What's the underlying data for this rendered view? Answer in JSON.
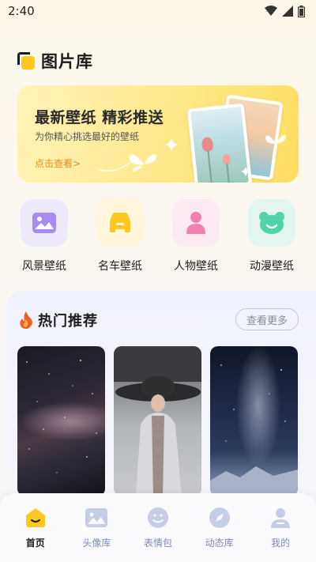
{
  "status": {
    "time": "2:40"
  },
  "header": {
    "title": "图片库"
  },
  "banner": {
    "title": "最新壁纸 精彩推送",
    "subtitle": "为你精心挑选最好的壁纸",
    "link": "点击查看>"
  },
  "categories": [
    {
      "label": "风景壁纸",
      "icon": "landscape-icon",
      "bg": "#ece9fb",
      "color": "#a78bf0"
    },
    {
      "label": "名车壁纸",
      "icon": "car-icon",
      "bg": "#fff6dc",
      "color": "#ffc81e"
    },
    {
      "label": "人物壁纸",
      "icon": "person-icon",
      "bg": "#fde9f2",
      "color": "#f47fb0"
    },
    {
      "label": "动漫壁纸",
      "icon": "bear-icon",
      "bg": "#e2f6ef",
      "color": "#4ed4a8"
    }
  ],
  "hot": {
    "title": "热门推荐",
    "more": "查看更多"
  },
  "tabs": [
    {
      "label": "首页",
      "icon": "home-icon",
      "active": true
    },
    {
      "label": "头像库",
      "icon": "image-icon",
      "active": false
    },
    {
      "label": "表情包",
      "icon": "smiley-icon",
      "active": false
    },
    {
      "label": "动态库",
      "icon": "compass-icon",
      "active": false
    },
    {
      "label": "我的",
      "icon": "user-icon",
      "active": false
    }
  ],
  "colors": {
    "accent": "#ffc81e",
    "tab_inactive": "#7d89b5",
    "link": "#f08a1a"
  }
}
